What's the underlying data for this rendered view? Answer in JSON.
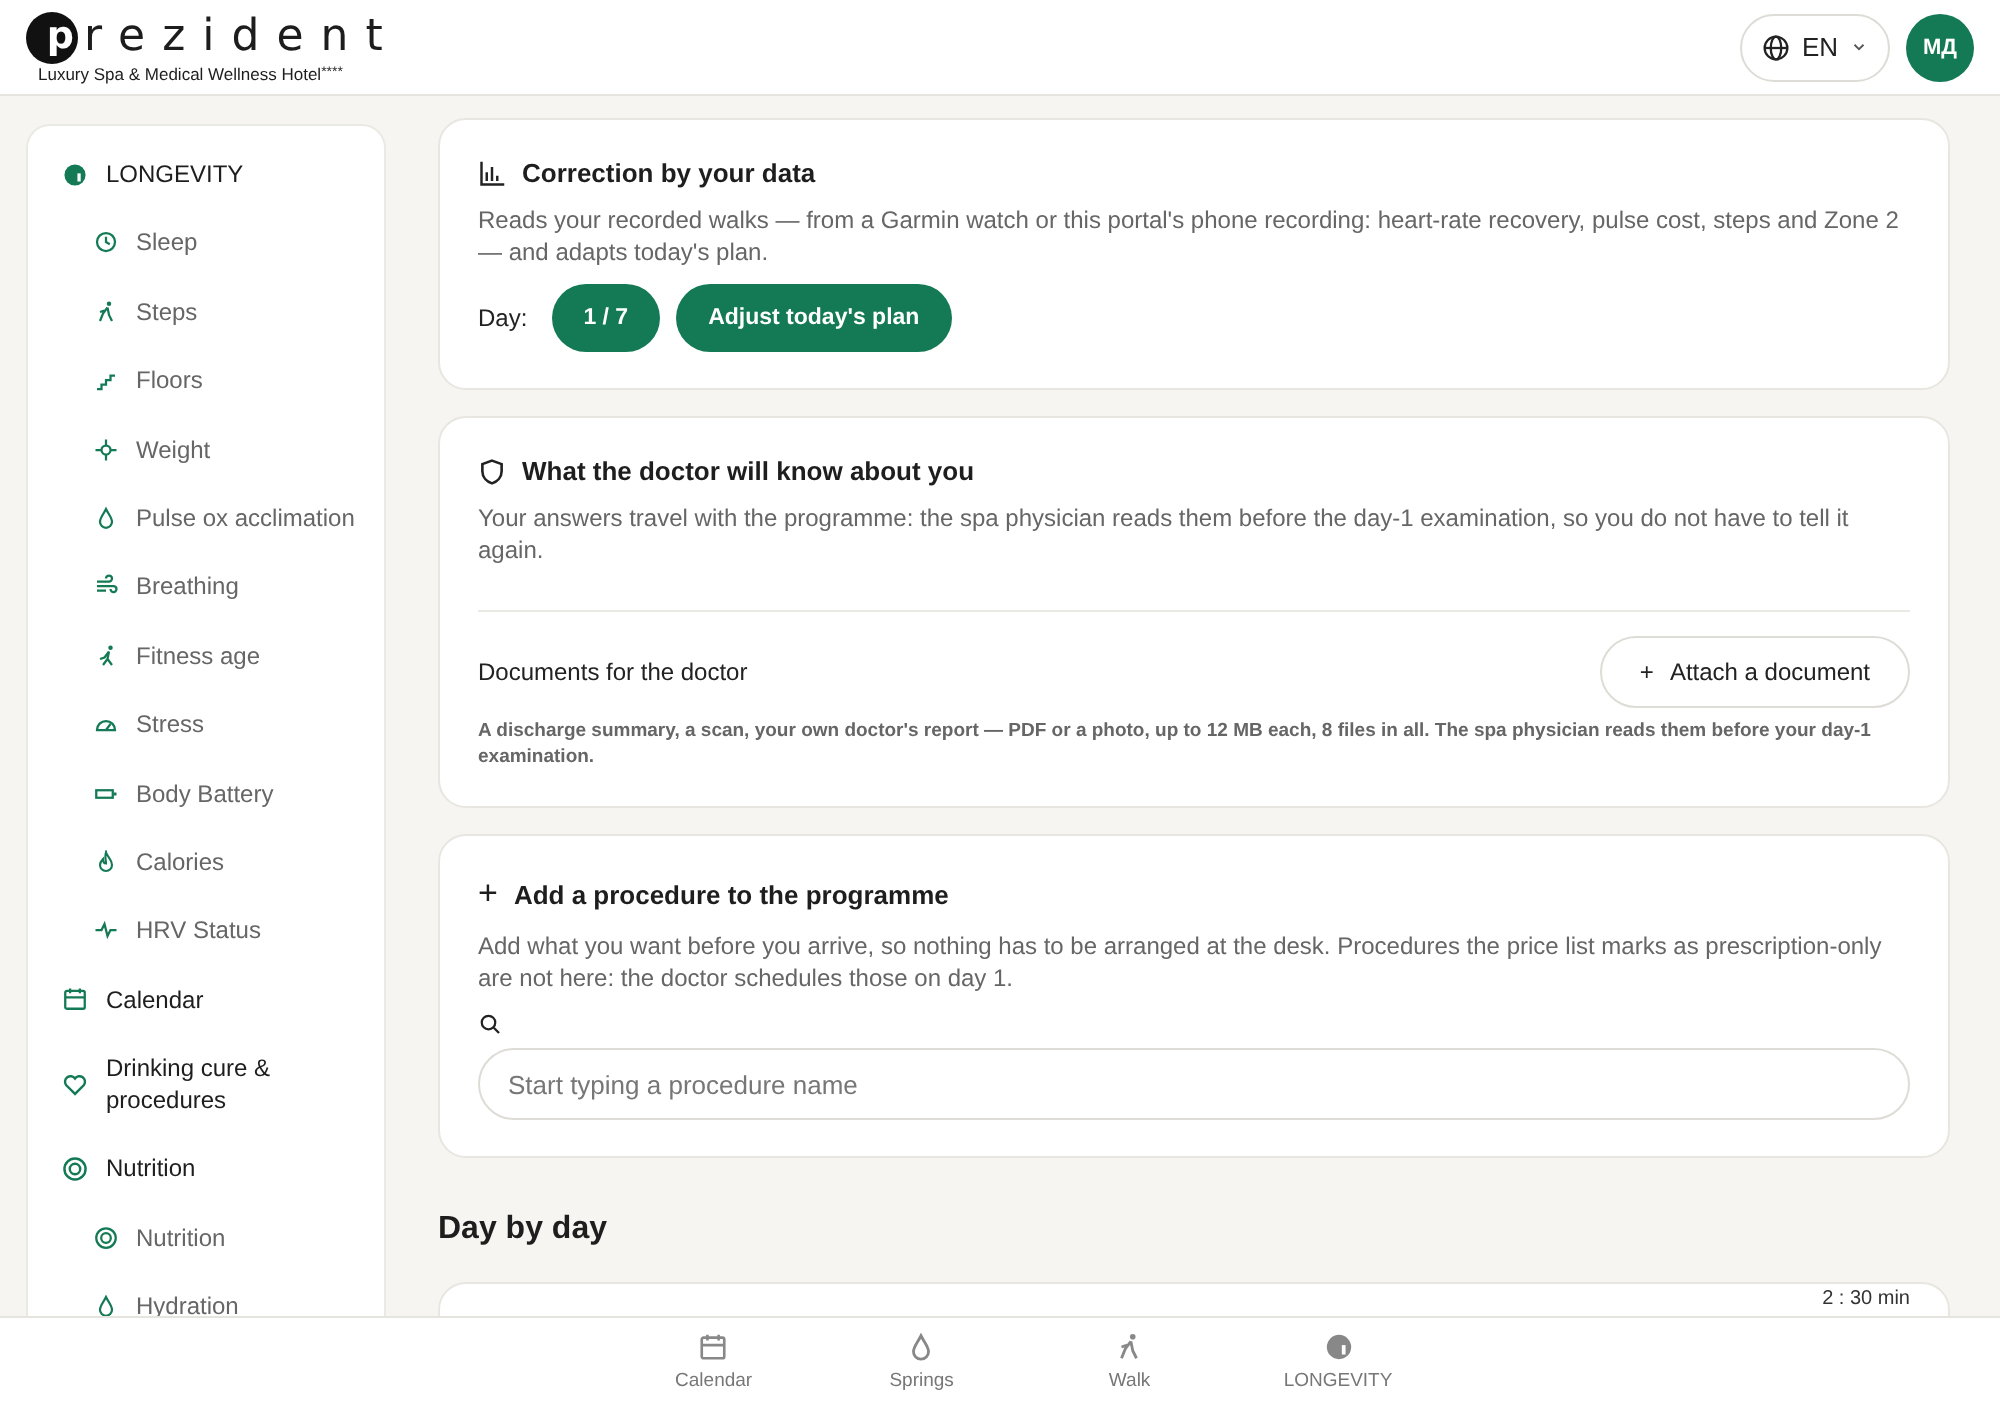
{
  "header": {
    "logo_mark": "p",
    "logo_name": "rezident",
    "logo_tagline": "Luxury Spa & Medical Wellness Hotel",
    "logo_stars": "****",
    "language": "EN",
    "avatar_initials": "МД"
  },
  "sidebar": {
    "items": [
      {
        "label": "LONGEVITY",
        "children": [
          {
            "label": "Sleep"
          },
          {
            "label": "Steps"
          },
          {
            "label": "Floors"
          },
          {
            "label": "Weight"
          },
          {
            "label": "Pulse ox acclimation"
          },
          {
            "label": "Breathing"
          },
          {
            "label": "Fitness age"
          },
          {
            "label": "Stress"
          },
          {
            "label": "Body Battery"
          },
          {
            "label": "Calories"
          },
          {
            "label": "HRV Status"
          }
        ]
      },
      {
        "label": "Calendar"
      },
      {
        "label": "Drinking cure & procedures"
      },
      {
        "label": "Nutrition",
        "children": [
          {
            "label": "Nutrition"
          },
          {
            "label": "Hydration"
          }
        ]
      }
    ]
  },
  "correction": {
    "title": "Correction by your data",
    "text": "Reads your recorded walks — from a Garmin watch or this portal's phone recording: heart-rate recovery, pulse cost, steps and Zone 2 — and adapts today's plan.",
    "day_label": "Day:",
    "day_value": "1 / 7",
    "action": "Adjust today's plan"
  },
  "doctor": {
    "title": "What the doctor will know about you",
    "text": "Your answers travel with the programme: the spa physician reads them before the day-1 examination, so you do not have to tell it again.",
    "documents_label": "Documents for the doctor",
    "attach": "Attach a document",
    "attach_icon": "+",
    "note": "A discharge summary, a scan, your own doctor's report — PDF or a photo, up to 12 MB each, 8 files in all. The spa physician reads them before your day-1 examination."
  },
  "procedure": {
    "title_icon": "+",
    "title": "Add a procedure to the programme",
    "text": "Add what you want before you arrive, so nothing has to be arranged at the desk. Procedures the price list marks as prescription-only are not here: the doctor schedules those on day 1.",
    "placeholder": "Start typing a procedure name"
  },
  "day_by_day": {
    "heading": "Day by day",
    "duration": "2 : 30 min"
  },
  "bottom_nav": [
    {
      "label": "Calendar"
    },
    {
      "label": "Springs"
    },
    {
      "label": "Walk"
    },
    {
      "label": "LONGEVITY"
    }
  ]
}
